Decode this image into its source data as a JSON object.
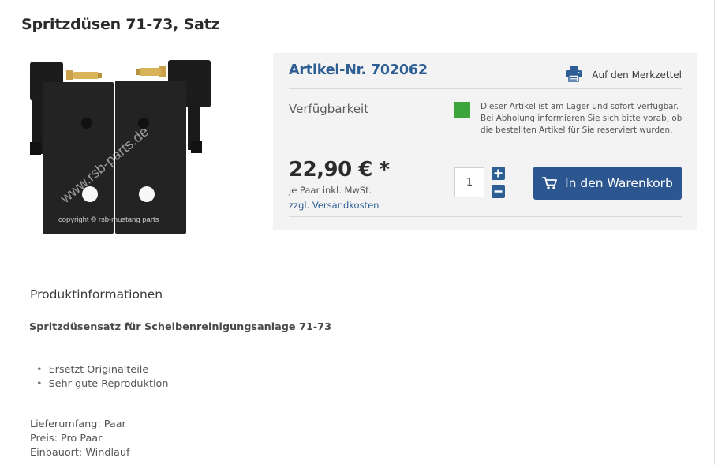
{
  "product": {
    "title": "Spritzdüsen 71-73, Satz",
    "image_watermark": "www.rsb-parts.de",
    "image_copyright": "copyright © rsb-mustang parts"
  },
  "buybox": {
    "article_number": "Artikel-Nr. 702062",
    "wishlist_label": "Auf den Merkzettel",
    "availability_label": "Verfügbarkeit",
    "availability_text": "Dieser Artikel ist am Lager und sofort verfügbar. Bei Abholung informieren Sie sich bitte vorab, ob die bestellten Artikel für Sie reserviert wurden.",
    "price": "22,90 € *",
    "price_note": "je Paar inkl. MwSt.",
    "shipping_link": "zzgl. Versandkosten",
    "quantity": "1",
    "add_to_cart_label": "In den Warenkorb"
  },
  "info": {
    "heading": "Produktinformationen",
    "subtitle": "Spritzdüsensatz für Scheibenreinigungsanlage 71-73",
    "features": [
      "Ersetzt Originalteile",
      "Sehr gute Reproduktion"
    ],
    "details": [
      "Lieferumfang: Paar",
      "Preis: Pro Paar",
      "Einbauort: Windlauf"
    ]
  },
  "colors": {
    "accent": "#2d5e94",
    "button": "#2b5690",
    "in_stock": "#3aa53a",
    "buybox_bg": "#f3f3f3"
  },
  "icons": {
    "wishlist": "printer-icon",
    "cart": "shopping-cart-icon",
    "quantity_increase": "plus-icon",
    "quantity_decrease": "minus-icon",
    "stock": "stock-status-indicator"
  }
}
